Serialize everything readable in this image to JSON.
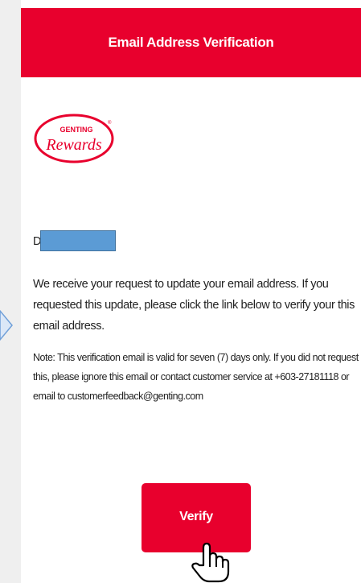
{
  "email": {
    "header_title": "Email Address Verification",
    "logo": {
      "top_text": "GENTING",
      "script_text": "Rewards",
      "mark": "®"
    },
    "greeting": "Dea",
    "body": "We receive your request to update your email address. If you requested this update, please click the link below to verify your this email address.",
    "note": "Note: This verification email is valid for seven (7) days only. If you did not request this, please ignore this email or contact customer service at +603-27181118 or email to customerfeedback@genting.com",
    "verify_label": "Verify"
  },
  "icons": {
    "pointer": "hand-pointer-icon",
    "arrow": "chevron-right-icon"
  },
  "colors": {
    "brand_red": "#e8002d",
    "redaction_blue": "#5b9bd5",
    "arrow_blue": "#6f9fd8"
  }
}
